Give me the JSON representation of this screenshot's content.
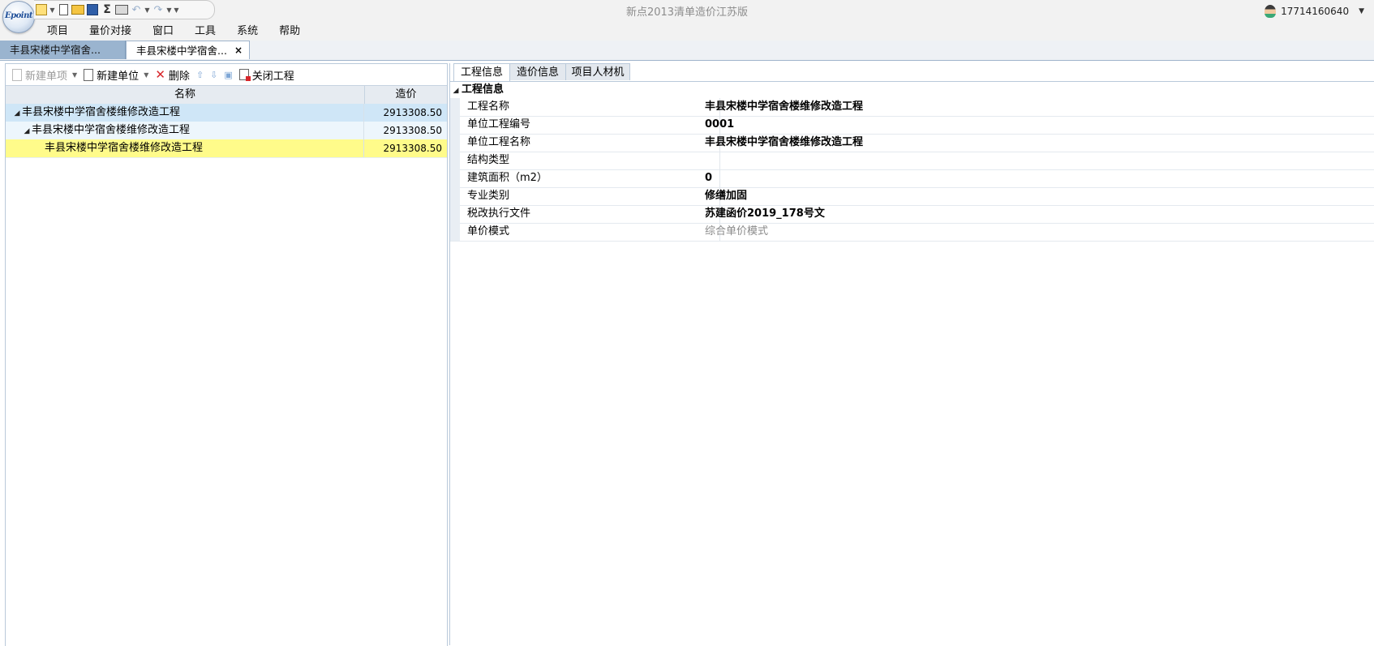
{
  "app": {
    "title": "新点2013清单造价江苏版",
    "logo_text": "Epoint",
    "user": "17714160640"
  },
  "menu": [
    "项目",
    "量价对接",
    "窗口",
    "工具",
    "系统",
    "帮助"
  ],
  "doc_tabs": [
    {
      "label": "丰县宋楼中学宿舍..."
    },
    {
      "label": "丰县宋楼中学宿舍...",
      "close": "×"
    }
  ],
  "left_toolbar": {
    "new_item": "新建单项",
    "new_unit": "新建单位",
    "delete": "删除",
    "close_project": "关闭工程"
  },
  "tree": {
    "headers": {
      "name": "名称",
      "price": "造价"
    },
    "rows": [
      {
        "name": "丰县宋楼中学宿舍楼维修改造工程",
        "price": "2913308.50"
      },
      {
        "name": "丰县宋楼中学宿舍楼维修改造工程",
        "price": "2913308.50"
      },
      {
        "name": "丰县宋楼中学宿舍楼维修改造工程",
        "price": "2913308.50"
      }
    ]
  },
  "prop_tabs": [
    "工程信息",
    "造价信息",
    "项目人材机"
  ],
  "properties": {
    "section": "工程信息",
    "rows": [
      {
        "label": "工程名称",
        "value": "丰县宋楼中学宿舍楼维修改造工程"
      },
      {
        "label": "单位工程编号",
        "value": "0001"
      },
      {
        "label": "单位工程名称",
        "value": "丰县宋楼中学宿舍楼维修改造工程"
      },
      {
        "label": "结构类型",
        "value": ""
      },
      {
        "label": "建筑面积（m2）",
        "value": "0"
      },
      {
        "label": "专业类别",
        "value": "修缮加固"
      },
      {
        "label": "税改执行文件",
        "value": "苏建函价2019_178号文"
      },
      {
        "label": "单价模式",
        "value": "综合单价模式"
      }
    ]
  },
  "colors": {
    "active_doc_tab": "#9ab4cf",
    "highlight_row": "#fffb8a",
    "selected_row": "#cfe6f7",
    "delete_icon": "#d8262b"
  }
}
